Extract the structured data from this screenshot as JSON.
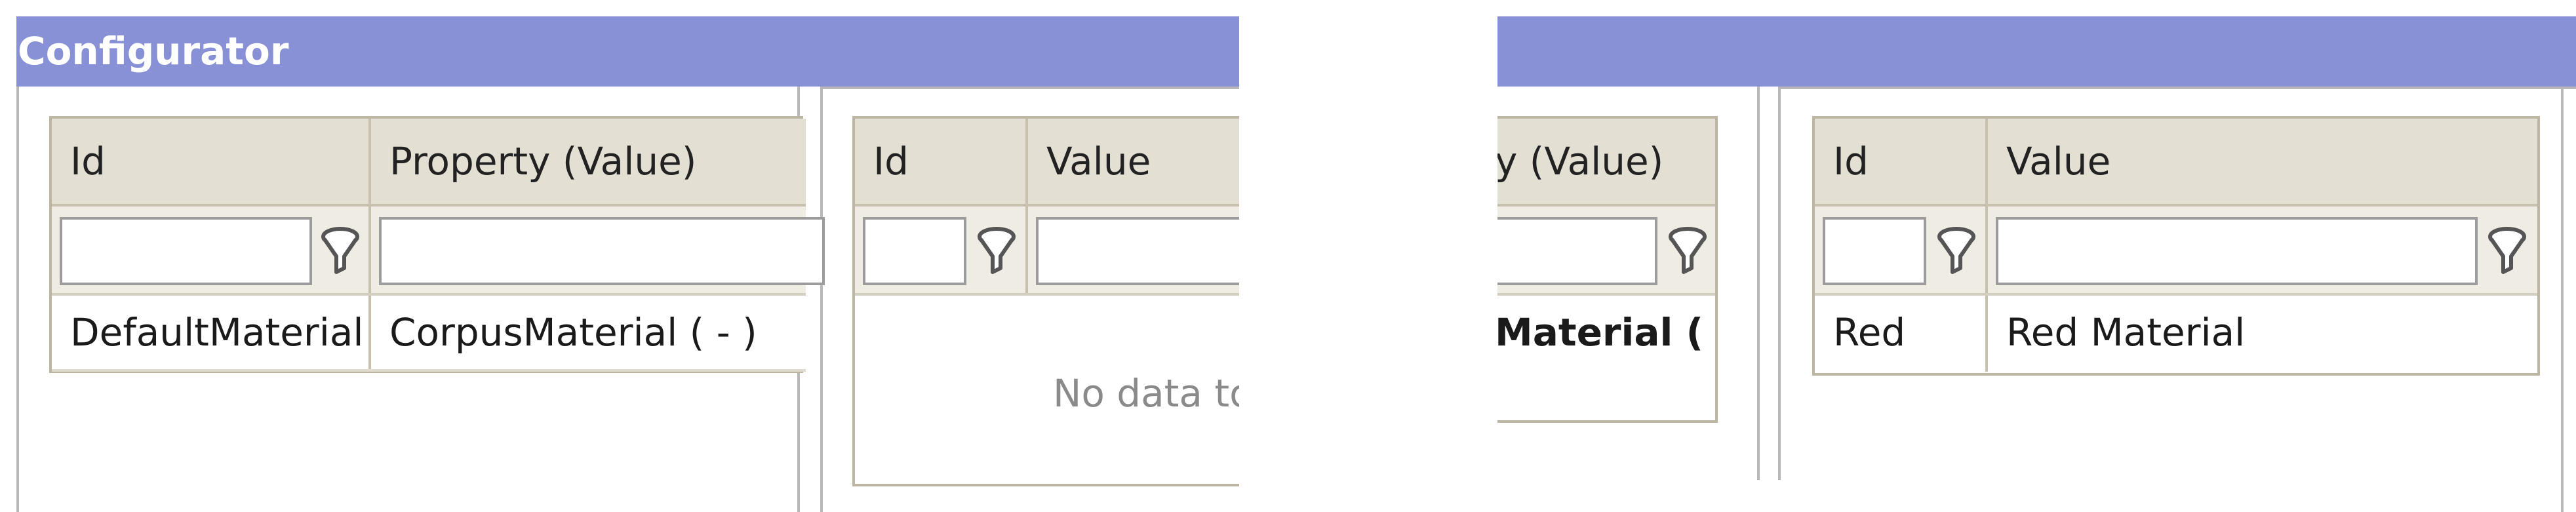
{
  "left_window": {
    "title": "Configurator",
    "property_grid": {
      "columns": [
        "Id",
        "Property (Value)"
      ],
      "filter_values": [
        "",
        ""
      ],
      "rows": [
        {
          "id": "DefaultMaterial",
          "property_value": "CorpusMaterial ( - )"
        }
      ]
    },
    "value_grid": {
      "columns": [
        "Id",
        "Value"
      ],
      "filter_values": [
        "",
        ""
      ],
      "empty_text": "No data to"
    }
  },
  "right_window": {
    "property_grid": {
      "visible_header_fragment": "y (Value)",
      "visible_cell_fragment": "Material ("
    },
    "value_grid": {
      "columns": [
        "Id",
        "Value"
      ],
      "filter_values": [
        "",
        ""
      ],
      "rows": [
        {
          "id": "Red",
          "value": "Red Material"
        }
      ]
    }
  },
  "colors": {
    "titlebar": "#8891d6",
    "grid_header": "#e3dfd2",
    "grid_border": "#bdb6a3"
  },
  "icons": [
    "filter-icon"
  ]
}
